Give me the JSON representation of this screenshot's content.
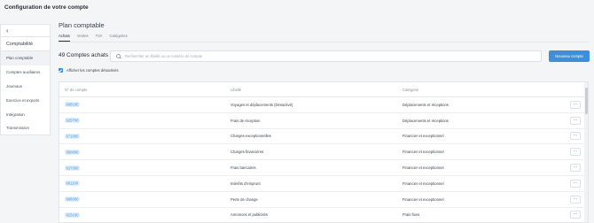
{
  "app_title": "Configuration de votre compte",
  "sidebar": {
    "back_icon": "chevron-left-icon",
    "section_title": "Comptabilité",
    "items": [
      {
        "label": "Plan comptable",
        "active": true
      },
      {
        "label": "Comptes auxiliaires",
        "active": false
      },
      {
        "label": "Journaux",
        "active": false
      },
      {
        "label": "Exercice et exports",
        "active": false
      },
      {
        "label": "Intégration",
        "active": false
      },
      {
        "label": "Transmission",
        "active": false
      }
    ]
  },
  "main": {
    "title": "Plan comptable",
    "tabs": [
      {
        "label": "Achats",
        "active": true
      },
      {
        "label": "Ventes",
        "active": false
      },
      {
        "label": "TVA",
        "active": false
      },
      {
        "label": "Catégories",
        "active": false
      }
    ],
    "count_label": "49 Comptes achats",
    "search": {
      "placeholder": "Rechercher un libellé ou un numéro de compte",
      "value": ""
    },
    "new_button": "Nouveau compte",
    "show_disabled": {
      "label": "Afficher les comptes désactivés",
      "checked": true
    },
    "table": {
      "headers": [
        "N° de compte",
        "Libellé",
        "Catégorie"
      ],
      "rows": [
        {
          "account": "606100",
          "label": "Voyages et déplacements (Désactivé)",
          "category": "Déplacements et réceptions"
        },
        {
          "account": "625700",
          "label": "Frais de réception",
          "category": "Déplacements et réceptions"
        },
        {
          "account": "671000",
          "label": "Charges exceptionnelles",
          "category": "Financier et exceptionnel"
        },
        {
          "account": "660000",
          "label": "Charges financières",
          "category": "Financier et exceptionnel"
        },
        {
          "account": "627000",
          "label": "Frais bancaires",
          "category": "Financier et exceptionnel"
        },
        {
          "account": "661100",
          "label": "Intérêts d'emprunt",
          "category": "Financier et exceptionnel"
        },
        {
          "account": "666000",
          "label": "Perte de change",
          "category": "Financier et exceptionnel"
        },
        {
          "account": "623100",
          "label": "Annonces et publicités",
          "category": "Frais fixes"
        }
      ],
      "more_icon": "ellipsis-icon"
    }
  }
}
